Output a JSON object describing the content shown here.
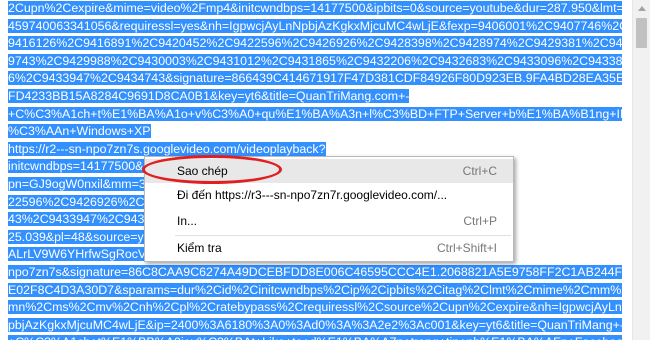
{
  "lines": [
    {
      "segments": [
        {
          "t": "2Cupn%2Cexpire&mime=video%2Fmp4&initcwndbps=14177500&ipbits=0&source=youtube&dur=287.950&lmt=1",
          "s": true
        }
      ]
    },
    {
      "segments": [
        {
          "t": "459740063341056&requiressl=yes&nh=IgpwcjAyLnNpbjAzKgkxMjcuMC4wLjE&fexp=9406001%2C9407746%2C",
          "s": true
        }
      ]
    },
    {
      "segments": [
        {
          "t": "9416126%2C9416891%2C9420452%2C9422596%2C9426926%2C9428398%2C9428974%2C9429381%2C942",
          "s": true
        }
      ]
    },
    {
      "segments": [
        {
          "t": "9743%2C9429988%2C9430003%2C9431012%2C9431865%2C9432206%2C9432683%2C9433096%2C943385",
          "s": true
        }
      ]
    },
    {
      "segments": [
        {
          "t": "6%2C9433947%2C9434743&signature=866439C414671917F47D381CDF84926F80D923EB.9FA4BD28EA35E",
          "s": true
        }
      ]
    },
    {
      "segments": [
        {
          "t": "FD4233BB15A8284C9691D8CA0B1&key=yt6&title=QuanTriMang.com+-",
          "s": true
        }
      ]
    },
    {
      "segments": [
        {
          "t": "+C%C3%A1ch+t%E1%BA%A1o+v%C3%A0+qu%E1%BA%A3n+l%C3%BD+FTP+Server+b%E1%BA%B1ng+IIS+tr",
          "s": true
        }
      ]
    },
    {
      "segments": [
        {
          "t": "%C3%AAn+Windows+XP",
          "s": true
        }
      ]
    },
    {
      "segments": [
        {
          "t": "https://r2---sn-npo7zn7s.googlevideo.com/videoplayback?",
          "s": true
        }
      ]
    },
    {
      "segments": [
        {
          "t": "initcwndbps=14177500&exp",
          "s": true
        },
        {
          "t": "                                                   ",
          "s": false
        },
        {
          "t": "e=video%2Fmp4&u",
          "s": true
        }
      ]
    },
    {
      "segments": [
        {
          "t": "pn=GJ9ogW0nxil&mm=31&",
          "s": true
        },
        {
          "t": "                                                     ",
          "s": false
        },
        {
          "t": "C9421504%2C94",
          "s": true
        }
      ]
    },
    {
      "segments": [
        {
          "t": "22596%2C9426926%2C942",
          "s": true
        },
        {
          "t": "                                                     ",
          "s": false
        },
        {
          "t": "9433400%2C94336",
          "s": true
        }
      ]
    },
    {
      "segments": [
        {
          "t": "43%2C9433947%2C943395",
          "s": true
        },
        {
          "t": "                                                     ",
          "s": false
        },
        {
          "t": "918&sver=3&dur=1",
          "s": true
        }
      ]
    },
    {
      "segments": [
        {
          "t": "25.039&pl=48&source=you",
          "s": true
        }
      ]
    },
    {
      "segments": [
        {
          "t": "ALrLV9W6YHrfwSgRocVOG",
          "s": true
        }
      ]
    },
    {
      "segments": [
        {
          "t": "npo7zn7s&signature=86C8CAA9C6274A49DCEBFDD8E006C46595CCC4E1.2068821A5E9758FF2C1AB244FE",
          "s": true
        }
      ]
    },
    {
      "segments": [
        {
          "t": "E02F8C4D3A30D7&sparams=dur%2Cid%2Cinitcwndbps%2Cip%2Cipbits%2Citag%2Clmt%2Cmime%2Cmm%2C",
          "s": true
        }
      ]
    },
    {
      "segments": [
        {
          "t": "mn%2Cms%2Cmv%2Cnh%2Cpl%2Cratebypass%2Crequiressl%2Csource%2Cupn%2Cexpire&nh=IgpwcjAyLnN",
          "s": true
        }
      ]
    },
    {
      "segments": [
        {
          "t": "pbjAzKgkxMjcuMC4wLjE&ip=2400%3A6180%3A0%3Ad0%3A%3A2e2%3Ac001&key=yt6&title=QuanTriMang+-",
          "s": true
        }
      ]
    },
    {
      "segments": [
        {
          "t": "+C%C3%A1ch+t%E1%BB%A0i+v%C3%BAt+Like+to+d%E1%BA%A7n+trong+tin+nh%E1%BA%AFn+Facebook",
          "s": true
        }
      ]
    }
  ],
  "menu": {
    "copy": {
      "label": "Sao chép",
      "shortcut": "Ctrl+C"
    },
    "goto": {
      "label": "Đi đến https://r3---sn-npo7zn7r.googlevideo.com/...",
      "shortcut": ""
    },
    "print": {
      "label": "In...",
      "shortcut": "Ctrl+P"
    },
    "inspect": {
      "label": "Kiểm tra",
      "shortcut": "Ctrl+Shift+I"
    }
  },
  "watermark": {
    "text": "uantrimang"
  },
  "colors": {
    "selection": "#3390ff",
    "highlight": "#e02020"
  }
}
